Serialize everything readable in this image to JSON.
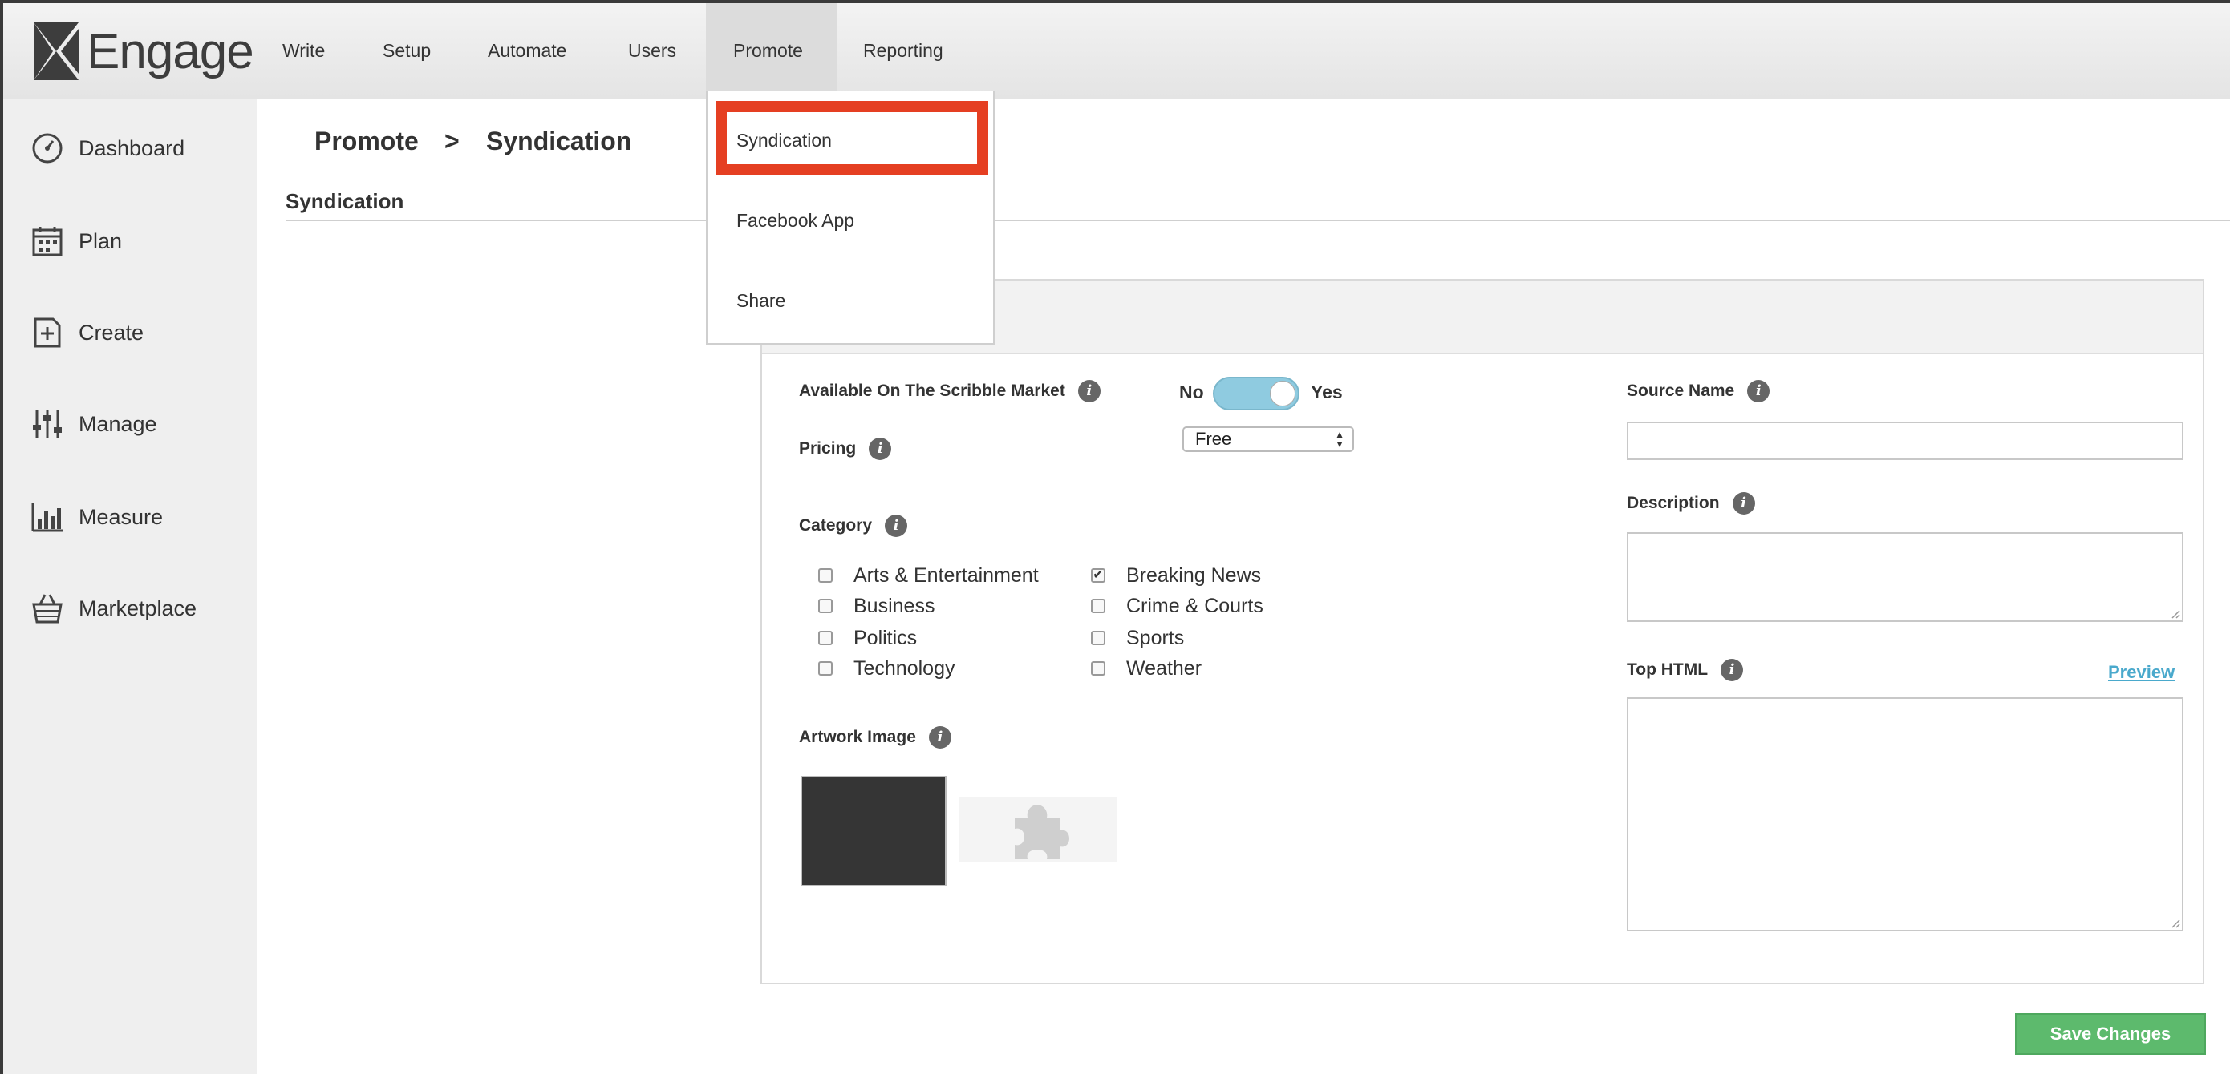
{
  "app": {
    "name": "Engage"
  },
  "nav": [
    {
      "label": "Write"
    },
    {
      "label": "Setup"
    },
    {
      "label": "Automate"
    },
    {
      "label": "Users"
    },
    {
      "label": "Promote"
    },
    {
      "label": "Reporting"
    }
  ],
  "sidebar": [
    {
      "label": "Dashboard",
      "icon": "dashboard-icon"
    },
    {
      "label": "Plan",
      "icon": "calendar-icon"
    },
    {
      "label": "Create",
      "icon": "add-document-icon"
    },
    {
      "label": "Manage",
      "icon": "sliders-icon"
    },
    {
      "label": "Measure",
      "icon": "bar-chart-icon"
    },
    {
      "label": "Marketplace",
      "icon": "basket-icon"
    }
  ],
  "breadcrumb": {
    "parent": "Promote",
    "separator": ">",
    "current": "Syndication"
  },
  "section_title": "Syndication",
  "dropdown": {
    "items": [
      {
        "label": "Syndication"
      },
      {
        "label": "Facebook App"
      },
      {
        "label": "Share"
      }
    ],
    "highlight_color": "#e53f22"
  },
  "form": {
    "market_label": "Available On The Scribble Market",
    "toggle_no": "No",
    "toggle_yes": "Yes",
    "toggle_on": true,
    "pricing_label": "Pricing",
    "pricing_value": "Free",
    "category_label": "Category",
    "categories": [
      {
        "label": "Arts & Entertainment",
        "checked": false
      },
      {
        "label": "Breaking News",
        "checked": true
      },
      {
        "label": "Business",
        "checked": false
      },
      {
        "label": "Crime & Courts",
        "checked": false
      },
      {
        "label": "Politics",
        "checked": false
      },
      {
        "label": "Sports",
        "checked": false
      },
      {
        "label": "Technology",
        "checked": false
      },
      {
        "label": "Weather",
        "checked": false
      }
    ],
    "artwork_label": "Artwork Image",
    "source_name_label": "Source Name",
    "source_name_value": "",
    "description_label": "Description",
    "description_value": "",
    "top_html_label": "Top HTML",
    "top_html_value": "",
    "preview_label": "Preview",
    "save_label": "Save Changes",
    "info_glyph": "i"
  },
  "colors": {
    "accent": "#8fcbe0",
    "save": "#5dba6d",
    "link": "#4aa9cc"
  }
}
